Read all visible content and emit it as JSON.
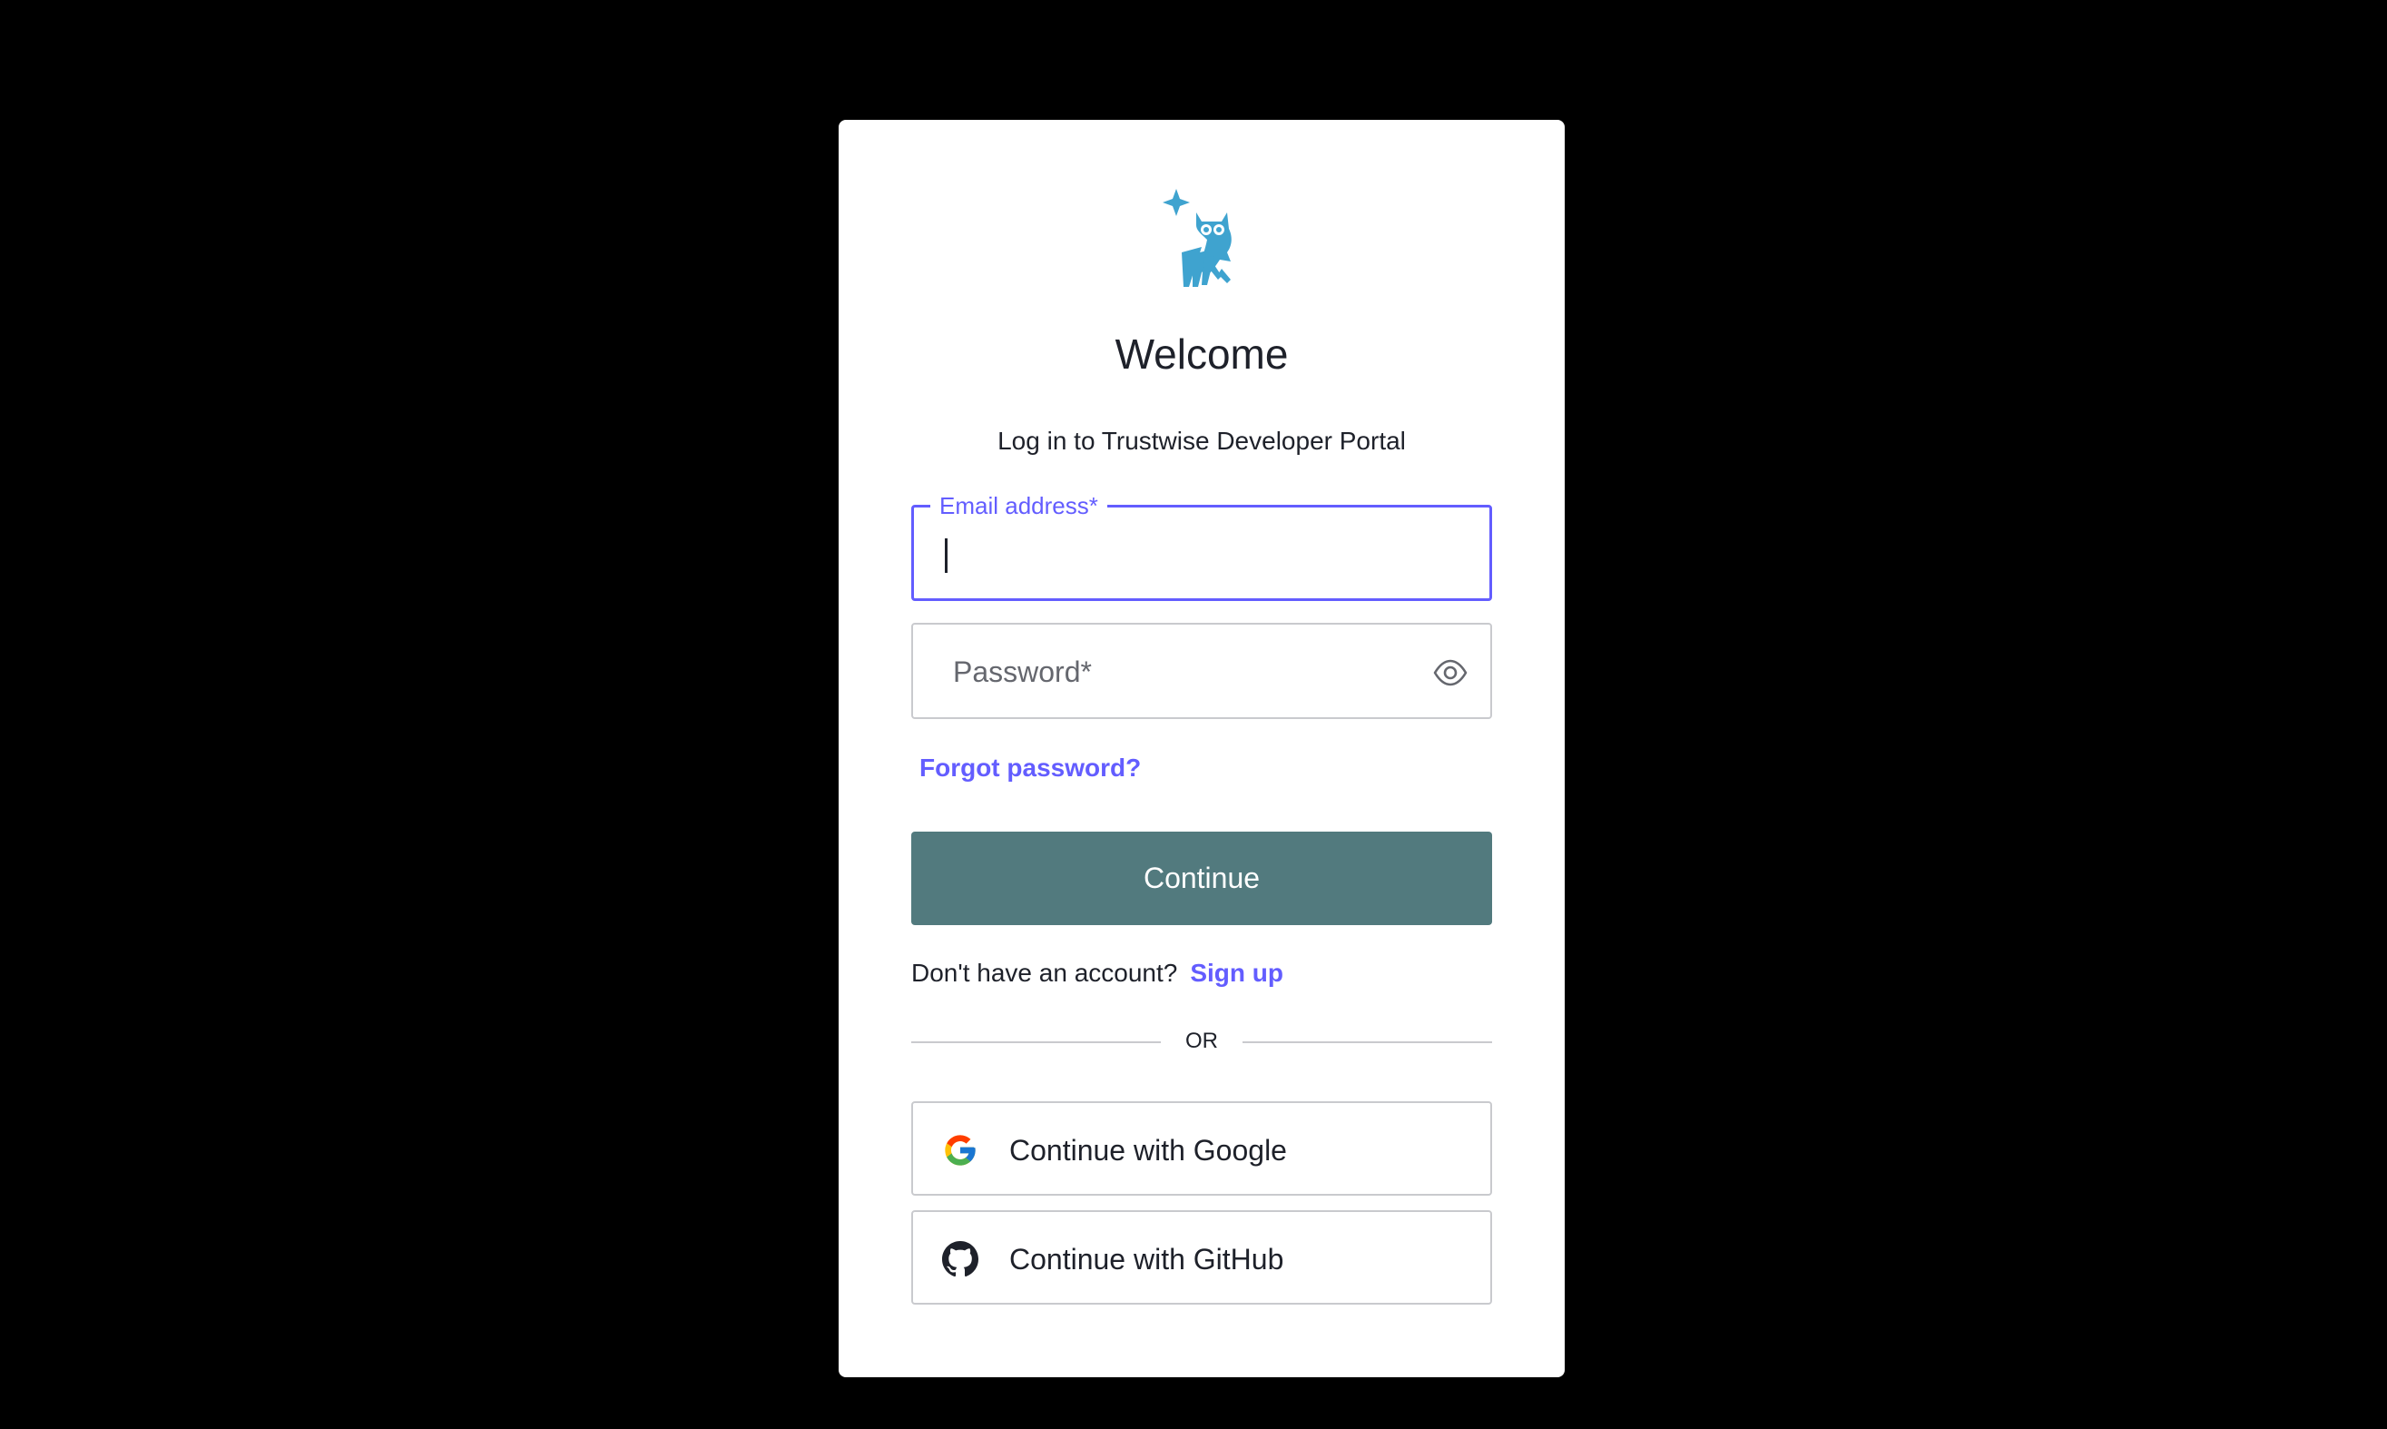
{
  "colors": {
    "background": "#000000",
    "card": "#ffffff",
    "accent": "#635dff",
    "primary_button": "#527a7e",
    "logo": "#3fa3cf",
    "text": "#1e212a",
    "border": "#c9cace"
  },
  "header": {
    "logo_icon": "owl-logo-icon",
    "title": "Welcome",
    "subtitle": "Log in to Trustwise Developer Portal"
  },
  "form": {
    "email": {
      "label": "Email address*",
      "value": ""
    },
    "password": {
      "placeholder": "Password*",
      "toggle_icon": "eye-icon"
    },
    "forgot_password": "Forgot password?",
    "continue_label": "Continue"
  },
  "signup": {
    "prompt": "Don't have an account?",
    "link": "Sign up"
  },
  "divider": {
    "text": "OR"
  },
  "social": {
    "google": {
      "label": "Continue with Google",
      "icon": "google-icon"
    },
    "github": {
      "label": "Continue with GitHub",
      "icon": "github-icon"
    }
  }
}
